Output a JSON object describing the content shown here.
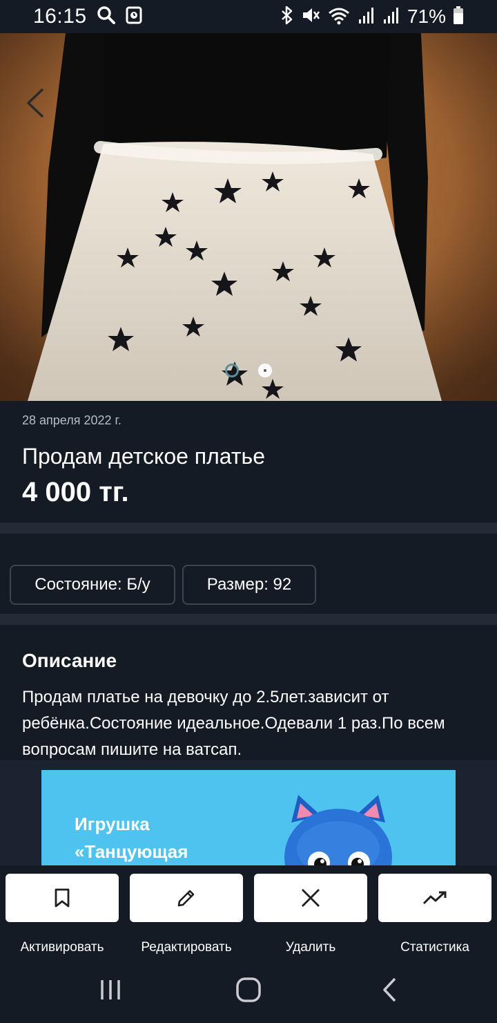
{
  "status_bar": {
    "time": "16:15",
    "battery_text": "71%",
    "icons": [
      "search-icon",
      "screenshot-icon",
      "bluetooth-icon",
      "mute-icon",
      "wifi-icon",
      "signal-icon",
      "signal-icon",
      "battery-icon"
    ]
  },
  "photo": {
    "back_icon": "chevron-left-icon",
    "page_count": 2,
    "active_index": 1
  },
  "listing": {
    "date": "28 апреля 2022 г.",
    "title": "Продам детское платье",
    "price": "4 000 тг."
  },
  "chips": [
    {
      "label": "Состояние: Б/у"
    },
    {
      "label": "Размер: 92"
    }
  ],
  "description": {
    "heading": "Описание",
    "text": "Продам платье на девочку до 2.5лет.зависит от ребёнка.Состояние идеальное.Одевали 1 раз.По всем вопросам пишите на ватсап."
  },
  "ad": {
    "line1": "Игрушка",
    "line2": "«Танцующая",
    "background": "#4fc3f0"
  },
  "actions": [
    {
      "label": "Активировать",
      "icon": "bookmark-icon"
    },
    {
      "label": "Редактировать",
      "icon": "pencil-icon"
    },
    {
      "label": "Удалить",
      "icon": "close-icon"
    },
    {
      "label": "Статистика",
      "icon": "trending-up-icon"
    }
  ],
  "nav": {
    "icons": [
      "recent-apps-icon",
      "home-icon",
      "back-icon"
    ]
  },
  "colors": {
    "background": "#141b24",
    "separator": "#232b36",
    "chip_border": "#3c4552",
    "text_secondary": "#b8bec7"
  }
}
